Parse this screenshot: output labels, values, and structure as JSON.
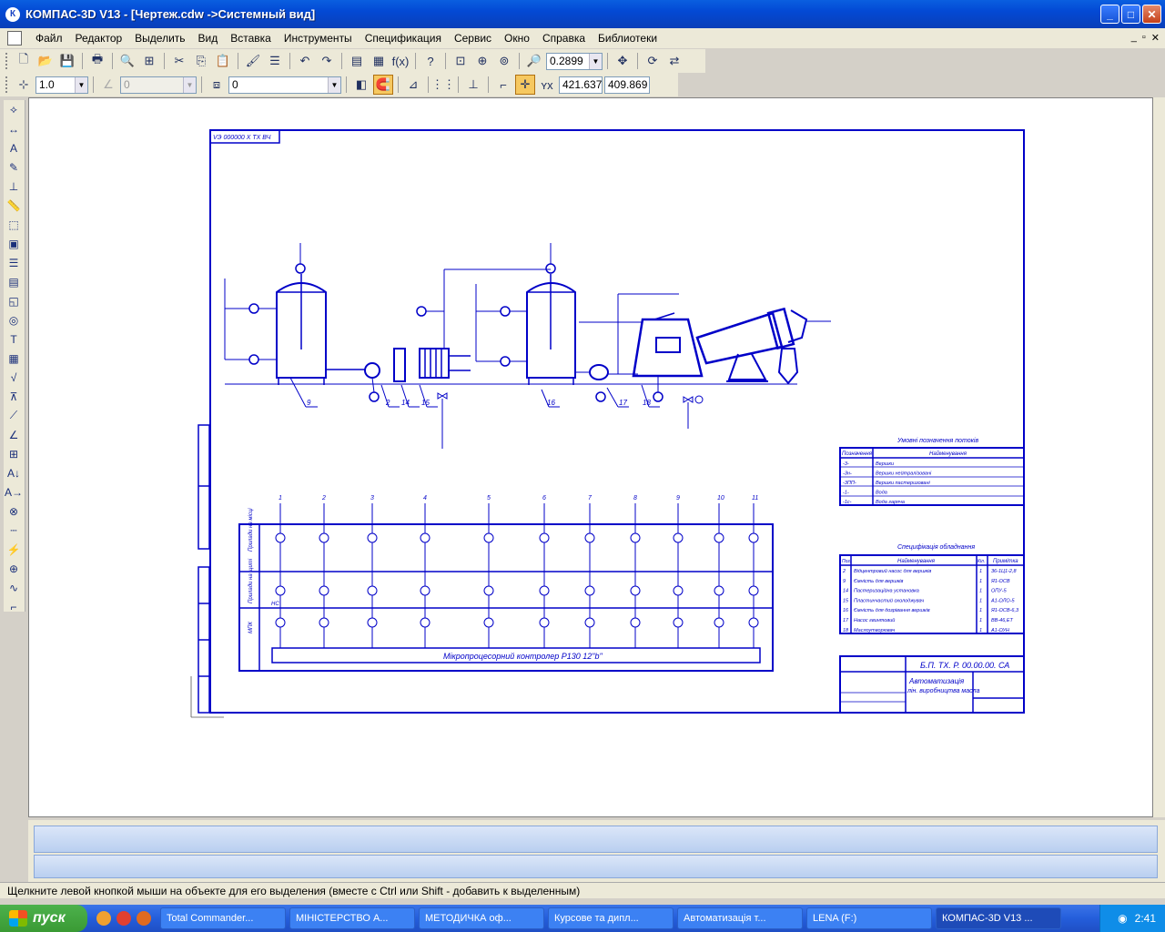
{
  "window": {
    "title": "КОМПАС-3D V13 - [Чертеж.cdw ->Системный вид]",
    "app_icon_text": "К"
  },
  "menu": [
    "Файл",
    "Редактор",
    "Выделить",
    "Вид",
    "Вставка",
    "Инструменты",
    "Спецификация",
    "Сервис",
    "Окно",
    "Справка",
    "Библиотеки"
  ],
  "toolbar": {
    "zoom_value": "0.2899",
    "step_value": "1.0",
    "angle_value": "0",
    "layer_value": "0",
    "coord_x": "421.637",
    "coord_y": "409.869"
  },
  "drawing": {
    "stamp_top": "VЭ 000000 Х ТХ ВЧ",
    "controller_label": "Мікропроцесорний контролер   Р130    12\"b\"",
    "doc_code": "Б.П. ТХ. Р. 00.00.00. СА",
    "doc_title_1": "Автоматизація",
    "doc_title_2": "лін. виробництва масла",
    "table1_title": "Умовні позначення потоків",
    "table1_header": [
      "Позначення",
      "Найменування"
    ],
    "table1_rows": [
      [
        "-3-",
        "Вершки"
      ],
      [
        "-3н-",
        "Вершки нейтралізовані"
      ],
      [
        "-3ПП-",
        "Вершки пастеризовані"
      ],
      [
        "-1-",
        "Вода"
      ],
      [
        "-1с-",
        "Вода гаряча"
      ]
    ],
    "table2_title": "Специфікація обладнання",
    "table2_header": [
      "Поз.",
      "Найменування",
      "Кіл.",
      "Примітка"
    ],
    "table2_rows": [
      [
        "2",
        "Відцентровий насос для вершків",
        "1",
        "36-1Ц1-2,8"
      ],
      [
        "9",
        "Ємність для вершків",
        "1",
        "Я1-ОСВ"
      ],
      [
        "14",
        "Пастеризаційна установка",
        "1",
        "ОПУ-5"
      ],
      [
        "15",
        "Пластинчастий охолоджувач",
        "1",
        "А1-ОЛО-5"
      ],
      [
        "16",
        "Ємність для дозрівання вершків",
        "1",
        "Я1-ОСВ-6,3"
      ],
      [
        "17",
        "Насос гвинтовий",
        "1",
        "ВВ-46,ЕТ"
      ],
      [
        "18",
        "Маслоутворювач",
        "1",
        "А1-ОУН"
      ]
    ],
    "labels": {
      "equipment": [
        "9",
        "2",
        "14",
        "15",
        "16",
        "17",
        "18"
      ],
      "columns": [
        "1",
        "2",
        "3",
        "4",
        "5",
        "6",
        "7",
        "8",
        "9",
        "10",
        "11"
      ],
      "rows": [
        "Прилади на місці",
        "Прилади на щиті",
        "МПК"
      ],
      "row2_extra": "НС"
    }
  },
  "status_text": "Щелкните левой кнопкой мыши на объекте для его выделения (вместе с Ctrl или Shift - добавить к выделенным)",
  "taskbar": {
    "start_label": "пуск",
    "tasks": [
      "Total Commander...",
      "МІНІСТЕРСТВО А...",
      "МЕТОДИЧКА оф...",
      "Курсове та дипл...",
      "Автоматизація т...",
      "LENA (F:)",
      "КОМПАС-3D V13 ..."
    ],
    "clock": "2:41"
  }
}
